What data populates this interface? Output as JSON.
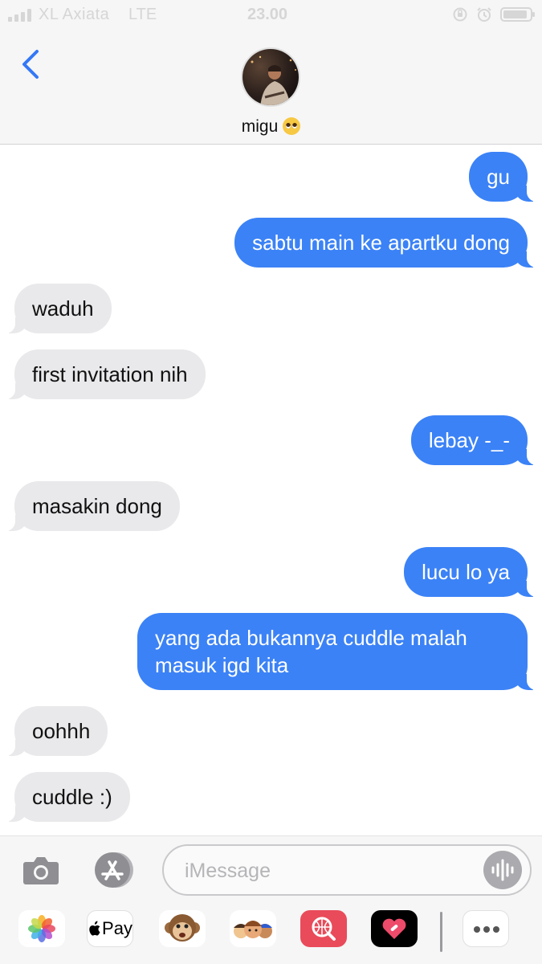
{
  "status_bar": {
    "carrier": "XL Axiata",
    "network": "LTE",
    "time": "23.00",
    "battery_level": 0.9
  },
  "header": {
    "contact_name": "migu",
    "contact_emoji": "pleading-face-emoji",
    "back_icon": "chevron-left-icon"
  },
  "messages": [
    {
      "direction": "sent",
      "text": "gu"
    },
    {
      "direction": "sent",
      "text": "sabtu main ke apartku dong"
    },
    {
      "direction": "received",
      "text": "waduh"
    },
    {
      "direction": "received",
      "text": "first invitation nih"
    },
    {
      "direction": "sent",
      "text": "lebay -_-"
    },
    {
      "direction": "received",
      "text": "masakin dong"
    },
    {
      "direction": "sent",
      "text": "lucu lo ya"
    },
    {
      "direction": "sent",
      "text": "yang ada bukannya cuddle malah",
      "text_line2": "masuk igd kita"
    },
    {
      "direction": "received",
      "text": "oohhh"
    },
    {
      "direction": "received",
      "text": "cuddle :)"
    }
  ],
  "composer": {
    "placeholder": "iMessage",
    "camera_icon": "camera-icon",
    "appstore_icon": "app-store-icon",
    "audio_icon": "audio-waveform-icon"
  },
  "app_drawer": {
    "apple_pay_label": "Pay",
    "apps": [
      "photos-app-icon",
      "apple-pay-app-icon",
      "animoji-monkey-icon",
      "memoji-icon",
      "web-search-app-icon",
      "digital-touch-heart-icon",
      "more-apps-icon"
    ]
  },
  "colors": {
    "sent_bubble": "#3b82f6",
    "received_bubble": "#e9e9eb",
    "accent": "#3478f6"
  }
}
